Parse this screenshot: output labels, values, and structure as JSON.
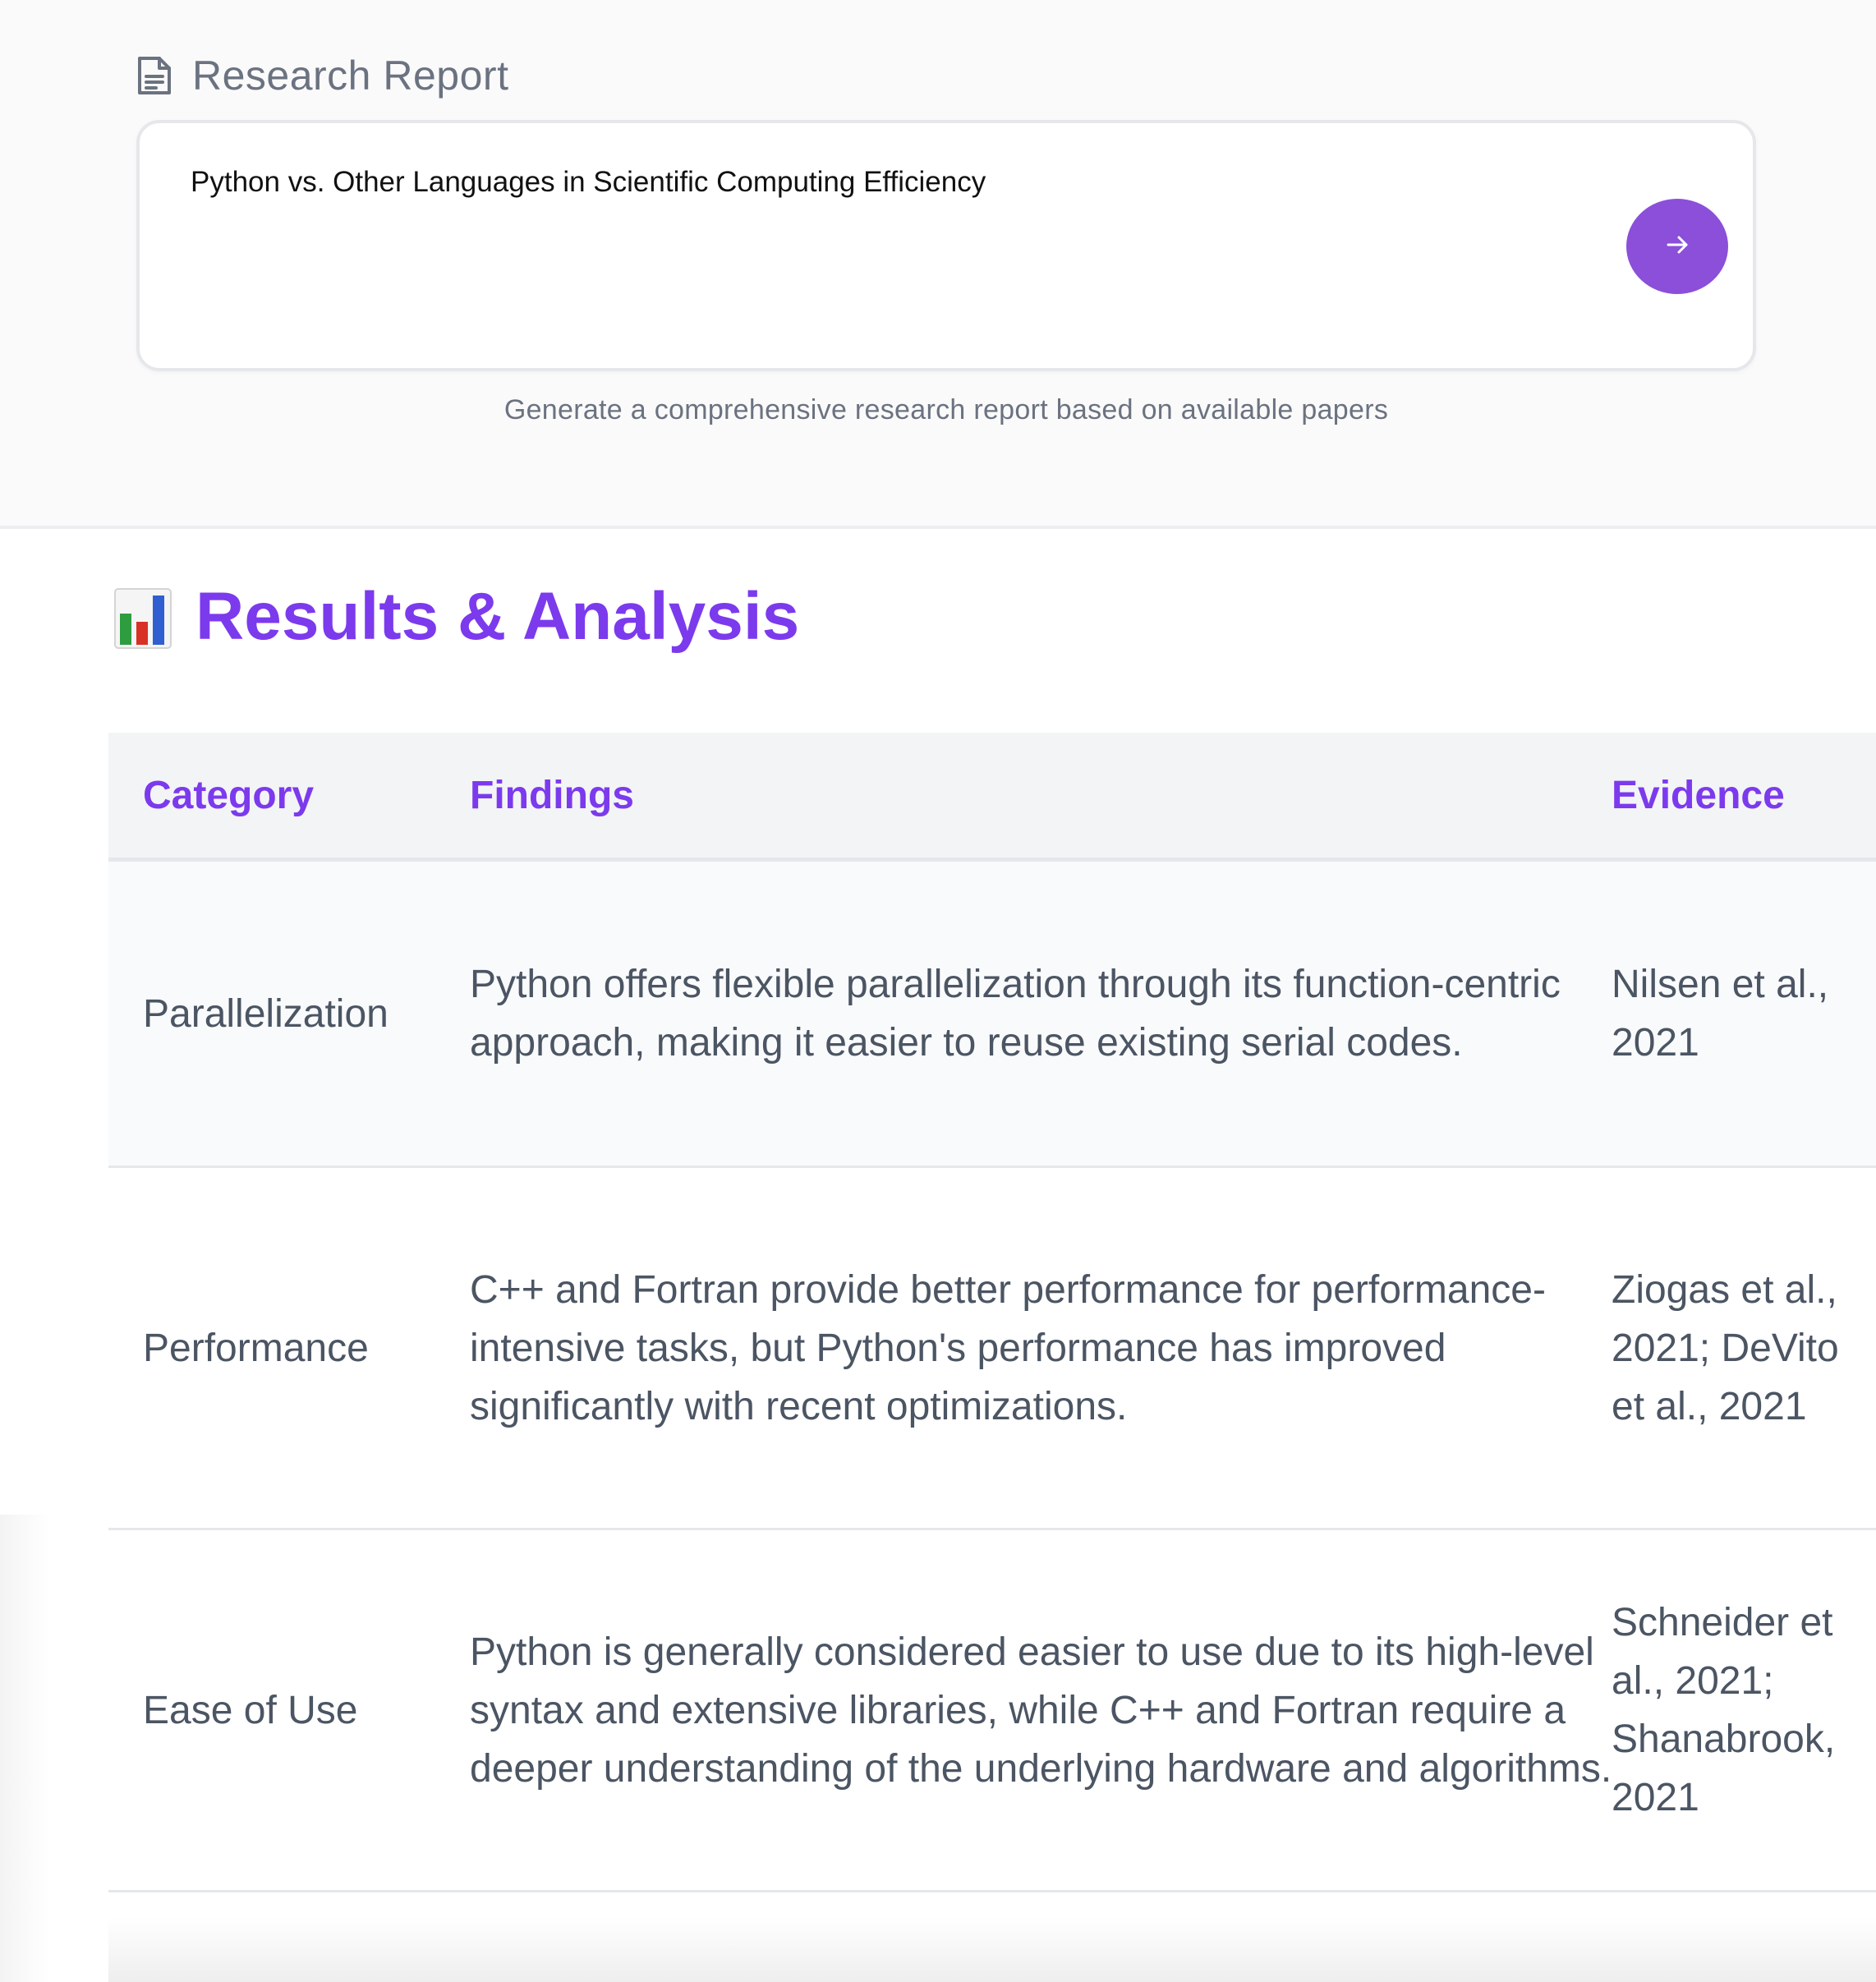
{
  "report_header": {
    "title": "Research Report",
    "icon": "document-icon"
  },
  "query_input": {
    "value": "Python vs. Other Languages in Scientific Computing Efficiency",
    "submit_icon": "arrow-right-icon"
  },
  "hint": "Generate a comprehensive research report based on available papers",
  "results": {
    "icon": "bar-chart-icon",
    "heading": "Results & Analysis",
    "columns": [
      "Category",
      "Findings",
      "Evidence"
    ],
    "rows": [
      {
        "category": "Parallelization",
        "findings": "Python offers flexible parallelization through its function-centric approach, making it easier to reuse existing serial codes.",
        "evidence": "Nilsen et al., 2021"
      },
      {
        "category": "Performance",
        "findings": "C++ and Fortran provide better performance for performance-intensive tasks, but Python's performance has improved significantly with recent optimizations.",
        "evidence": "Ziogas et al., 2021; DeVito et al., 2021"
      },
      {
        "category": "Ease of Use",
        "findings": "Python is generally considered easier to use due to its high-level syntax and extensive libraries, while C++ and Fortran require a deeper understanding of the underlying hardware and algorithms.",
        "evidence": "Schneider et al., 2021; Shanabrook, 2021"
      }
    ]
  },
  "colors": {
    "accent": "#7c3aed",
    "button": "#8b4fd9",
    "muted_text": "#6b7280",
    "body_text": "#4b5563"
  }
}
